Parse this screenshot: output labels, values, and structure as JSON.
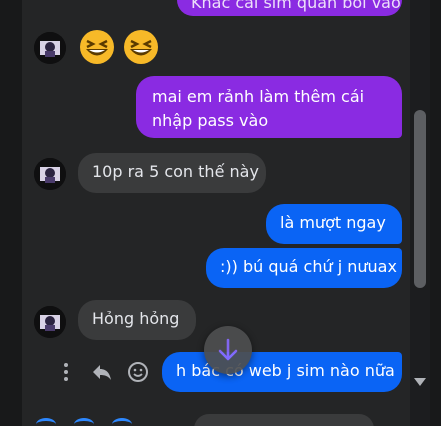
{
  "messages": [
    {
      "id": "m1",
      "text": "Khác cái sim quản bồi vào"
    },
    {
      "id": "m2",
      "text": "😆😆"
    },
    {
      "id": "m3",
      "text": "mai em rảnh làm thêm cái nhập pass vào",
      "lines": [
        "mai em rảnh làm thêm cái",
        "nhập pass vào"
      ]
    },
    {
      "id": "m4",
      "text": "10p ra 5 con thế này"
    },
    {
      "id": "m5",
      "text": "là mượt ngay"
    },
    {
      "id": "m6",
      "text": ":)) bú quá chứ j nưuax"
    },
    {
      "id": "m7",
      "text": "Hỏng hỏng"
    },
    {
      "id": "m8",
      "text": "h bác có web j sim nào nữa"
    }
  ],
  "icons": {
    "more": "more-vertical-icon",
    "reply": "reply-icon",
    "react": "smile-icon",
    "scroll": "arrow-down-icon"
  },
  "colors": {
    "background": "#242526",
    "incoming": "#3a3b3c",
    "outgoing_purple": "#8a2be2",
    "outgoing_blue": "#0a64f5",
    "accent": "#8a6cff"
  }
}
